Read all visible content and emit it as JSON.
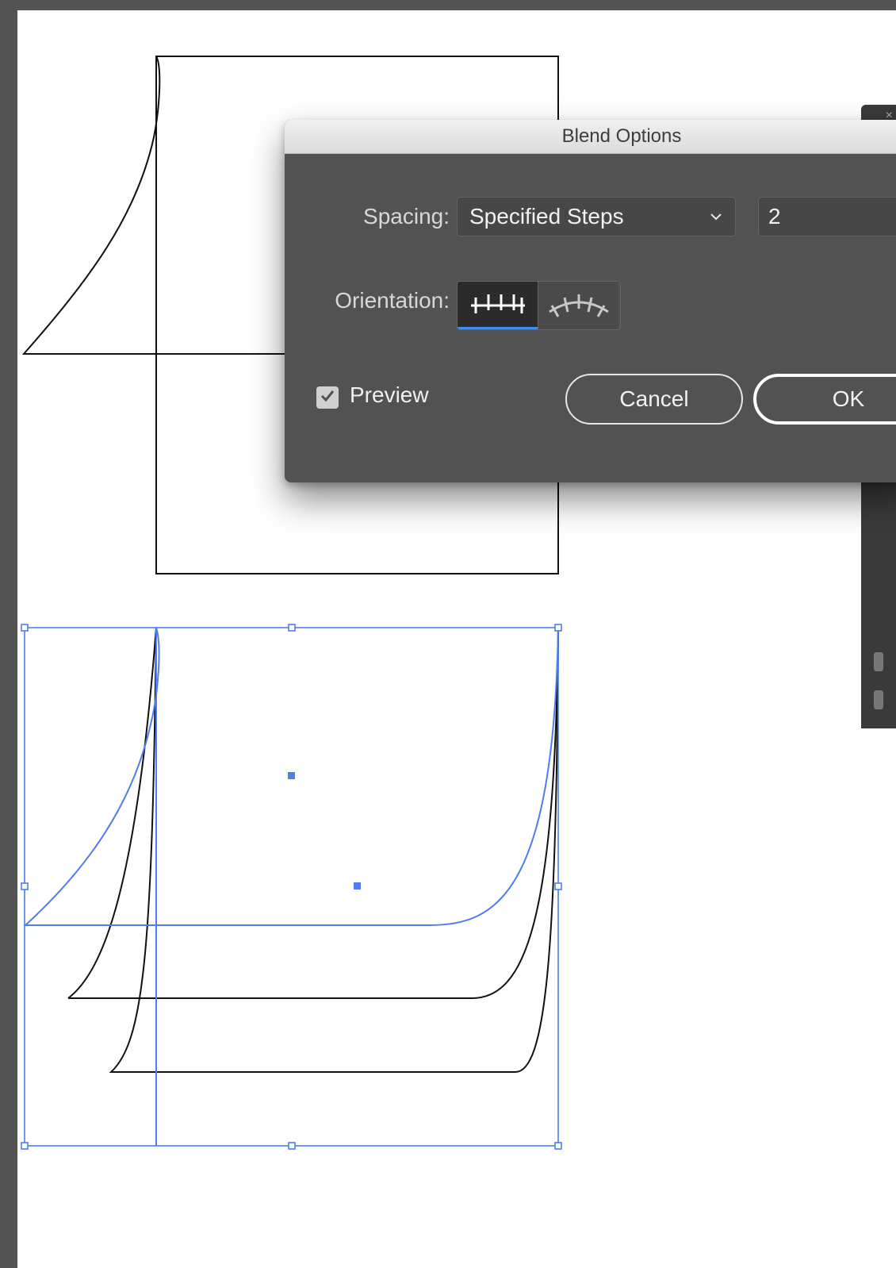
{
  "dialog": {
    "title": "Blend Options",
    "spacing_label": "Spacing:",
    "spacing_value": "Specified Steps",
    "steps_value": "2",
    "orientation_label": "Orientation:",
    "orientation_options": [
      "align-to-page-icon",
      "align-to-path-icon"
    ],
    "orientation_selected": "align-to-page",
    "preview_label": "Preview",
    "preview_checked": true,
    "cancel_label": "Cancel",
    "ok_label": "OK"
  },
  "colors": {
    "selection": "#4f7cf0",
    "dialog_bg": "#525252",
    "canvas_bg": "#535353",
    "artboard": "#ffffff"
  }
}
